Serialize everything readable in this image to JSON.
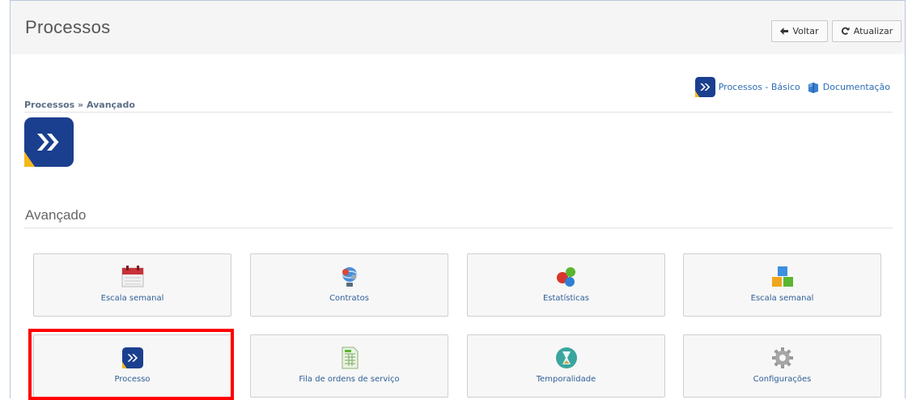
{
  "header": {
    "title": "Processos",
    "back_label": "Voltar",
    "refresh_label": "Atualizar"
  },
  "top_links": {
    "basic_label": "Processos - Básico",
    "docs_label": "Documentação"
  },
  "breadcrumb": "Processos » Avançado",
  "section_title": "Avançado",
  "tiles": [
    {
      "label": "Escala semanal",
      "icon": "calendar-icon"
    },
    {
      "label": "Contratos",
      "icon": "contracts-icon"
    },
    {
      "label": "Estatísticas",
      "icon": "statistics-icon"
    },
    {
      "label": "Escala semanal",
      "icon": "blocks-icon"
    },
    {
      "label": "Processo",
      "icon": "process-icon"
    },
    {
      "label": "Fila de ordens de serviço",
      "icon": "spreadsheet-icon"
    },
    {
      "label": "Temporalidade",
      "icon": "hourglass-icon"
    },
    {
      "label": "Configurações",
      "icon": "gear-icon"
    }
  ],
  "colors": {
    "brand_blue": "#1b3f8f",
    "link": "#2d6db5",
    "highlight": "#ff0000"
  }
}
